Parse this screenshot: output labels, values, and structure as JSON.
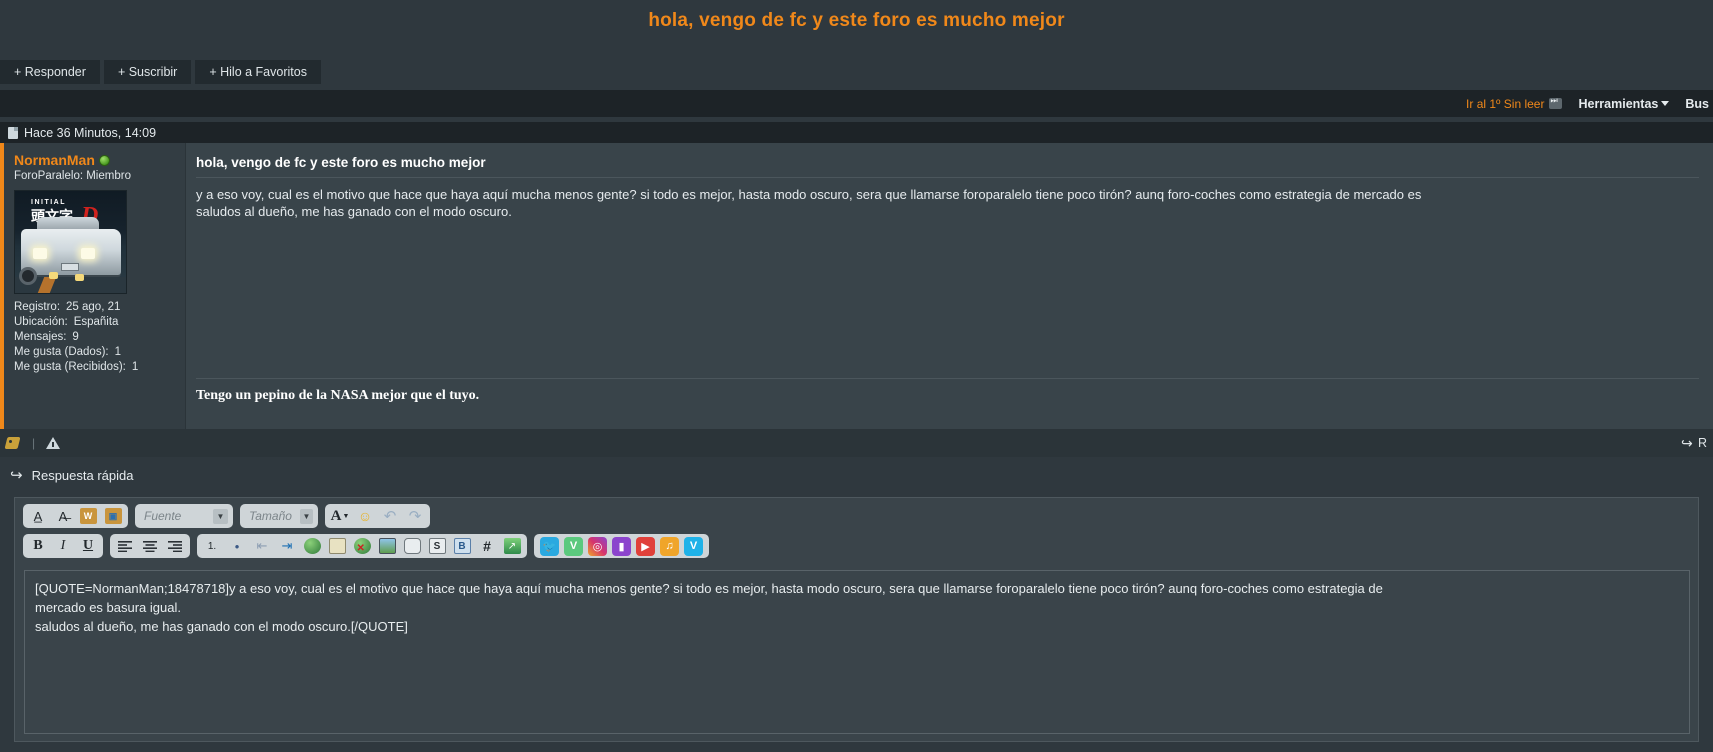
{
  "thread": {
    "title": "hola, vengo de fc y este foro es mucho mejor",
    "title_color": "#f0881a"
  },
  "actions": [
    {
      "label": "+ Responder",
      "name": "responder-button"
    },
    {
      "label": "+ Suscribir",
      "name": "suscribir-button"
    },
    {
      "label": "+ Hilo a Favoritos",
      "name": "hilo-favoritos-button"
    }
  ],
  "tools_bar": {
    "goto_unread": "Ir al 1º Sin leer",
    "herramientas": "Herramientas",
    "buscar": "Bus"
  },
  "post": {
    "timestamp": "Hace 36 Minutos, 14:09",
    "subject": "hola, vengo de fc y este foro es mucho mejor",
    "body_line_1": "y a eso voy, cual es el motivo que hace que haya aquí mucha menos gente? si todo es mejor, hasta modo oscuro, sera que llamarse foroparalelo tiene poco tirón? aunq foro-coches como estrategia de mercado es",
    "body_line_2": "saludos al dueño, me has ganado con el modo oscuro.",
    "signature": "Tengo un pepino de la NASA mejor que el tuyo.",
    "user": {
      "name": "NormanMan",
      "title": "ForoParalelo: Miembro",
      "avatar_alt": "Initial D",
      "stats": [
        {
          "label": "Registro:",
          "value": "25 ago, 21"
        },
        {
          "label": "Ubicación:",
          "value": "Españita"
        },
        {
          "label": "Mensajes:",
          "value": "9"
        },
        {
          "label": "Me gusta (Dados):",
          "value": "1"
        },
        {
          "label": "Me gusta (Recibidos):",
          "value": "1"
        }
      ]
    }
  },
  "post_footer": {
    "reply_label": "R"
  },
  "quick_reply": {
    "header": "Respuesta rápida",
    "toolbar_row1": {
      "font_select": "Fuente",
      "size_select": "Tamaño",
      "buttons": [
        {
          "name": "remove-format-icon",
          "glyph": "A̲"
        },
        {
          "name": "strip-format-icon",
          "glyph": "A̶"
        },
        {
          "name": "paste-word-icon",
          "glyph": "W"
        },
        {
          "name": "paste-plain-icon",
          "glyph": "P"
        }
      ],
      "color_button": "A",
      "smiley_button": "☺",
      "undo_button": "↶",
      "redo_button": "↷"
    },
    "toolbar_row2": {
      "bold": "B",
      "italic": "I",
      "underline": "U",
      "align_left": "≡",
      "align_center": "≡",
      "align_right": "≡",
      "ordered_list": "1.",
      "unordered_list": "•",
      "outdent": "⇤",
      "indent": "⇥",
      "link": "🌐",
      "email": "✉",
      "unlink": "🌐",
      "image": "🖼",
      "quote": "💬",
      "spoiler": "S",
      "bbcode": "B",
      "hash": "#",
      "attach": "↗",
      "social": [
        {
          "name": "twitter-icon",
          "glyph": "🐦",
          "color": "#2aa9e0"
        },
        {
          "name": "vine-icon",
          "glyph": "V",
          "color": "#5bc97e"
        },
        {
          "name": "instagram-icon",
          "glyph": "◙",
          "color": "#d6336c"
        },
        {
          "name": "twitch-icon",
          "glyph": "▮",
          "color": "#8b44cd"
        },
        {
          "name": "youtube-icon",
          "glyph": "▶",
          "color": "#e0403a"
        },
        {
          "name": "tiktok-music-icon",
          "glyph": "♫",
          "color": "#f0a52a"
        },
        {
          "name": "vimeo-icon",
          "glyph": "V",
          "color": "#1fb2e8"
        }
      ]
    },
    "textarea_value": "[QUOTE=NormanMan;18478718]y a eso voy, cual es el motivo que hace que haya aquí mucha menos gente? si todo es mejor, hasta modo oscuro, sera que llamarse foroparalelo tiene poco tirón? aunq foro-coches como estrategia de\nmercado es basura igual.\nsaludos al dueño, me has ganado con el modo oscuro.[/QUOTE]"
  }
}
